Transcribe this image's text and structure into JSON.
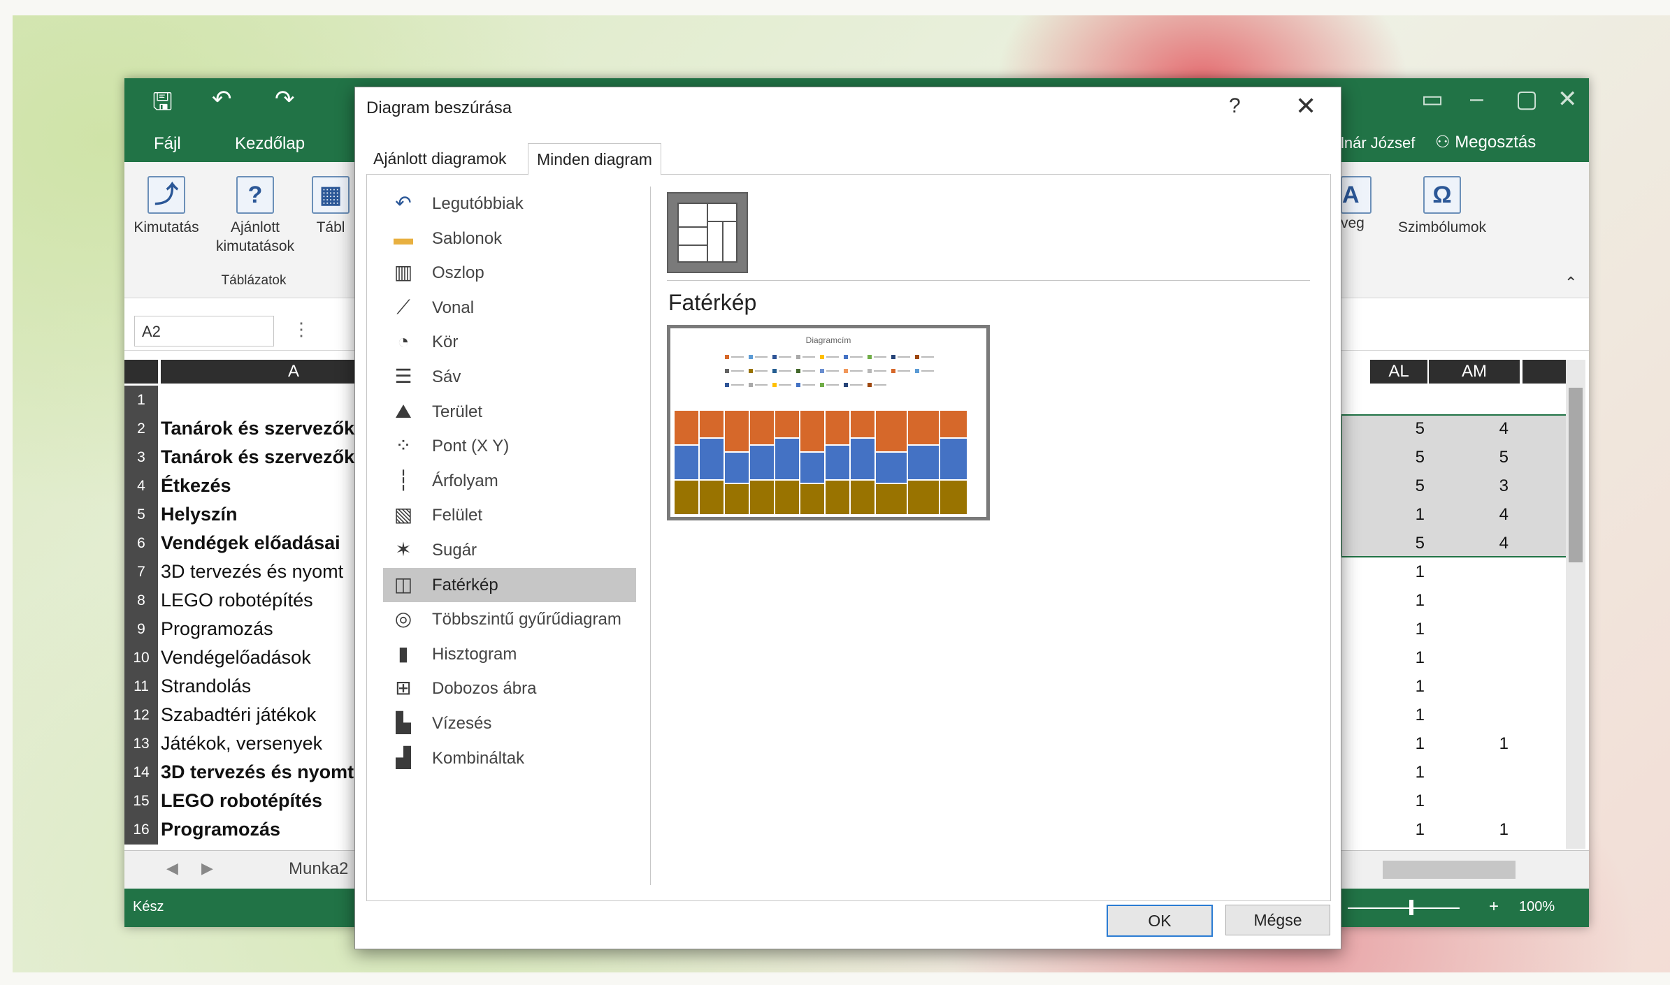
{
  "excel": {
    "tabs": [
      "Fájl",
      "Kezdőlap"
    ],
    "user_name": "lnár József",
    "share_label": "Megosztás",
    "ribbon": {
      "buttons": [
        "Kimutatás",
        "Ajánlott kimutatások",
        "Tábl"
      ],
      "group_label": "Táblázatok",
      "right_buttons": [
        "veg",
        "Szimbólumok"
      ]
    },
    "name_box": "A2",
    "columns": {
      "a": "A",
      "al": "AL",
      "am": "AM"
    },
    "rows": [
      {
        "num": "1",
        "text": "",
        "bold": false,
        "al": "",
        "am": ""
      },
      {
        "num": "2",
        "text": "Tanárok és szervezők",
        "bold": true,
        "al": "5",
        "am": "4"
      },
      {
        "num": "3",
        "text": "Tanárok és szervezők",
        "bold": true,
        "al": "5",
        "am": "5"
      },
      {
        "num": "4",
        "text": "Étkezés",
        "bold": true,
        "al": "5",
        "am": "3"
      },
      {
        "num": "5",
        "text": "Helyszín",
        "bold": true,
        "al": "1",
        "am": "4"
      },
      {
        "num": "6",
        "text": "Vendégek előadásai",
        "bold": true,
        "al": "5",
        "am": "4"
      },
      {
        "num": "7",
        "text": "3D tervezés és nyomt",
        "bold": false,
        "al": "1",
        "am": ""
      },
      {
        "num": "8",
        "text": "LEGO robotépítés",
        "bold": false,
        "al": "1",
        "am": ""
      },
      {
        "num": "9",
        "text": "Programozás",
        "bold": false,
        "al": "1",
        "am": ""
      },
      {
        "num": "10",
        "text": "Vendégelőadások",
        "bold": false,
        "al": "1",
        "am": ""
      },
      {
        "num": "11",
        "text": "Strandolás",
        "bold": false,
        "al": "1",
        "am": ""
      },
      {
        "num": "12",
        "text": "Szabadtéri játékok",
        "bold": false,
        "al": "1",
        "am": ""
      },
      {
        "num": "13",
        "text": "Játékok, versenyek",
        "bold": false,
        "al": "1",
        "am": "1"
      },
      {
        "num": "14",
        "text": "3D tervezés és nyomt",
        "bold": true,
        "al": "1",
        "am": ""
      },
      {
        "num": "15",
        "text": "LEGO robotépítés",
        "bold": true,
        "al": "1",
        "am": ""
      },
      {
        "num": "16",
        "text": "Programozás",
        "bold": true,
        "al": "1",
        "am": "1"
      }
    ],
    "sheet_tab": "Munka2",
    "status_ready": "Kész",
    "zoom": "100%"
  },
  "dialog": {
    "title": "Diagram beszúrása",
    "help": "?",
    "close": "✕",
    "tabs": [
      "Ajánlott diagramok",
      "Minden diagram"
    ],
    "active_tab": 1,
    "categories": [
      {
        "label": "Legutóbbiak",
        "icon": "recent-icon"
      },
      {
        "label": "Sablonok",
        "icon": "folder-icon"
      },
      {
        "label": "Oszlop",
        "icon": "column-chart-icon"
      },
      {
        "label": "Vonal",
        "icon": "line-chart-icon"
      },
      {
        "label": "Kör",
        "icon": "pie-chart-icon"
      },
      {
        "label": "Sáv",
        "icon": "bar-chart-icon"
      },
      {
        "label": "Terület",
        "icon": "area-chart-icon"
      },
      {
        "label": "Pont (X Y)",
        "icon": "scatter-chart-icon"
      },
      {
        "label": "Árfolyam",
        "icon": "stock-chart-icon"
      },
      {
        "label": "Felület",
        "icon": "surface-chart-icon"
      },
      {
        "label": "Sugár",
        "icon": "radar-chart-icon"
      },
      {
        "label": "Fatérkép",
        "icon": "treemap-icon"
      },
      {
        "label": "Többszintű gyűrűdiagram",
        "icon": "sunburst-icon"
      },
      {
        "label": "Hisztogram",
        "icon": "histogram-icon"
      },
      {
        "label": "Dobozos ábra",
        "icon": "box-whisker-icon"
      },
      {
        "label": "Vízesés",
        "icon": "waterfall-icon"
      },
      {
        "label": "Kombináltak",
        "icon": "combo-chart-icon"
      }
    ],
    "selected_category": 11,
    "chart_type_title": "Fatérkép",
    "preview_title": "Diagramcím",
    "ok_label": "OK",
    "cancel_label": "Mégse"
  }
}
